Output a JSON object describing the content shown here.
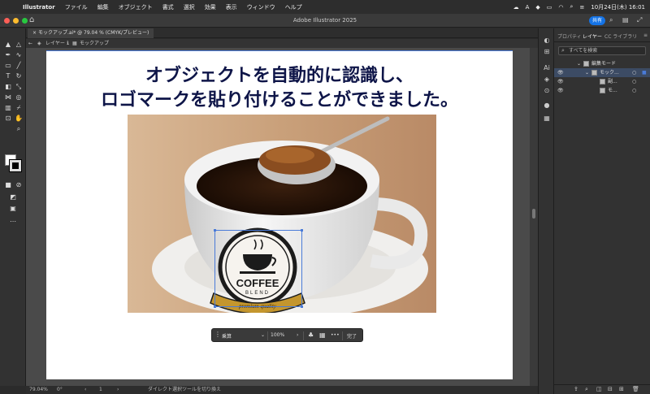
{
  "menubar": {
    "app_name": "Illustrator",
    "items": [
      "ファイル",
      "編集",
      "オブジェクト",
      "書式",
      "選択",
      "効果",
      "表示",
      "ウィンドウ",
      "ヘルプ"
    ],
    "datetime": "10月24日(木) 16:01"
  },
  "window": {
    "title": "Adobe Illustrator 2025",
    "share_label": "共有"
  },
  "document": {
    "tab_title": "モックアップ.ai* @ 79.04 % (CMYK/プレビュー)",
    "crumb_layer": "レイヤー 1",
    "crumb_group": "モックアップ"
  },
  "artboard": {
    "headline_line1": "オブジェクトを自動的に認識し、",
    "headline_line2": "ロゴマークを貼り付けることができました。",
    "logo_title": "COFFEE",
    "logo_sub": "BLEND",
    "logo_ribbon": "premium quality"
  },
  "context_bar": {
    "blend_mode": "乗算",
    "opacity": "100%",
    "done_label": "完了",
    "more_label": "•••"
  },
  "statusbar": {
    "zoom": "79.04%",
    "rotation": "0°",
    "artboard_index": "1",
    "tool_hint": "ダイレクト選択ツールを切り換え"
  },
  "panel": {
    "tabs": [
      "プロパティ",
      "レイヤー",
      "CC ライブラリ"
    ],
    "active_tab": "レイヤー",
    "search_placeholder": "すべてを検索",
    "layers": [
      {
        "name": "編集モード",
        "level": 0
      },
      {
        "name": "モック...",
        "level": 1,
        "selected": true
      },
      {
        "name": "副...",
        "level": 2
      },
      {
        "name": "モ...",
        "level": 2
      }
    ]
  },
  "colors": {
    "headline": "#0e1548",
    "accent": "#1473e6",
    "selection": "#4a7bd8"
  }
}
